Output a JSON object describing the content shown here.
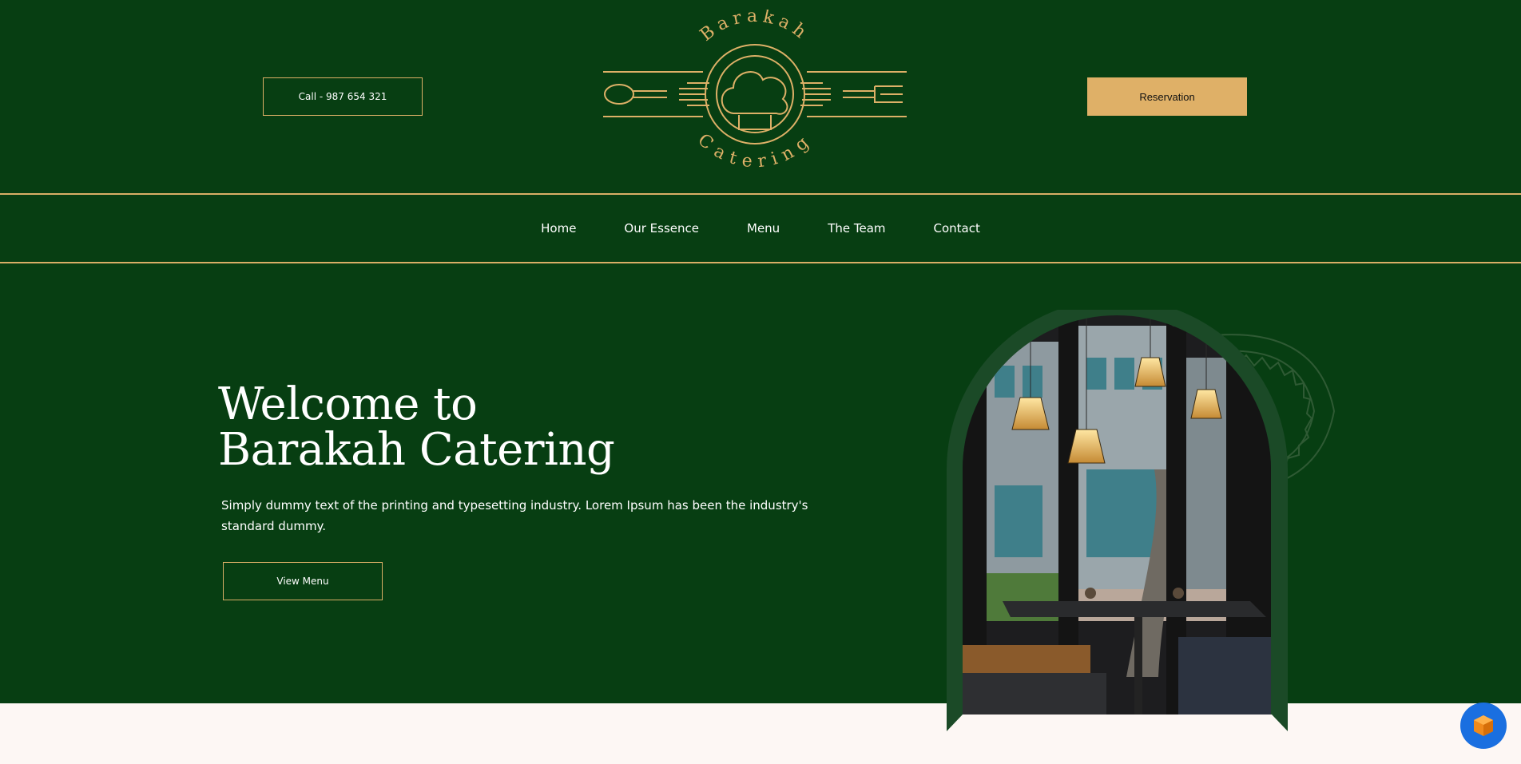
{
  "header": {
    "call_label": "Call - 987 654 321",
    "reservation_label": "Reservation",
    "logo_text_top": "Barakah",
    "logo_text_bottom": "Catering"
  },
  "nav": {
    "items": [
      {
        "label": "Home"
      },
      {
        "label": "Our Essence"
      },
      {
        "label": "Menu"
      },
      {
        "label": "The Team"
      },
      {
        "label": "Contact"
      }
    ]
  },
  "hero": {
    "title_line1": "Welcome to",
    "title_line2": "Barakah Catering",
    "description": "Simply dummy text of the printing and typesetting industry. Lorem Ipsum has been the industry's standard dummy.",
    "cta_label": "View Menu"
  },
  "colors": {
    "primary_green": "#073e12",
    "gold": "#dfb067",
    "cream": "#fdf7f4",
    "arch_frame": "#1b4a27"
  },
  "icons": {
    "logo": "chef-hat-logo-icon",
    "decoration": "gear-ornament-icon",
    "chat": "chat-widget-icon"
  }
}
